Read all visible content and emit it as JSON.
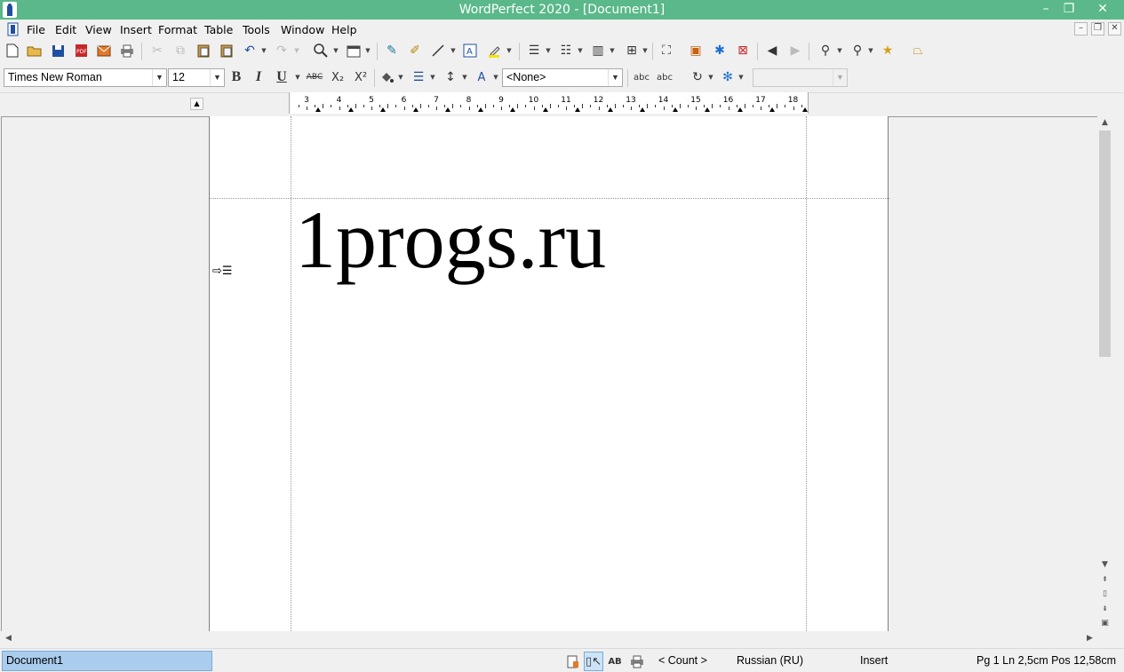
{
  "window": {
    "title": "WordPerfect 2020 - [Document1]",
    "minimize": "–",
    "restore": "❐",
    "close": "✕"
  },
  "menu": {
    "items": [
      {
        "label": "File"
      },
      {
        "label": "Edit"
      },
      {
        "label": "View"
      },
      {
        "label": "Insert"
      },
      {
        "label": "Format"
      },
      {
        "label": "Table"
      },
      {
        "label": "Tools"
      },
      {
        "label": "Window"
      },
      {
        "label": "Help"
      }
    ]
  },
  "toolbar2": {
    "font_name": "Times New Roman",
    "font_size": "12",
    "bold": "B",
    "italic": "I",
    "underline": "U",
    "strike": "ABC",
    "subscript": "X₂",
    "superscript": "X²",
    "style": "<None>",
    "abc1": "abc",
    "abc2": "abc",
    "zoom": ""
  },
  "ruler": {
    "numbers": [
      "3",
      "4",
      "5",
      "6",
      "7",
      "8",
      "9",
      "10",
      "11",
      "12",
      "13",
      "14",
      "15",
      "16",
      "17",
      "18"
    ]
  },
  "document": {
    "text": "1progs.ru"
  },
  "status": {
    "document_name": "Document1",
    "count": "< Count >",
    "language": "Russian (RU)",
    "mode": "Insert",
    "position": "Pg 1 Ln 2,5cm Pos 12,58cm",
    "ab": "AB"
  }
}
